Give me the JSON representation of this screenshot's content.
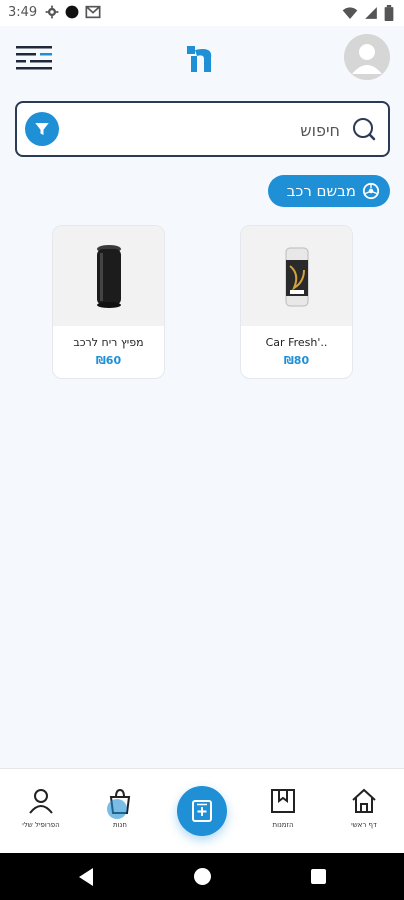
{
  "status_bar": {
    "time": "3:49",
    "icons": [
      "settings-icon",
      "dot-icon",
      "mail-icon",
      "wifi-icon",
      "signal-icon",
      "battery-icon"
    ]
  },
  "header": {
    "menu_icon": "menu-lines-icon",
    "logo": "app-logo",
    "avatar_icon": "user-avatar-icon"
  },
  "search": {
    "placeholder": "חיפוש",
    "value": ""
  },
  "category_chip": {
    "label": "מבשם רכב"
  },
  "products": [
    {
      "name": "Car Fresh'..",
      "price": "₪80"
    },
    {
      "name": "מפיץ ריח לרכב",
      "price": "₪60"
    }
  ],
  "bottom_nav": {
    "items": [
      {
        "label": "דף ראשי",
        "icon": "home-icon"
      },
      {
        "label": "הזמנות",
        "icon": "bookmark-icon"
      },
      {
        "label": "",
        "icon": "add-order-icon"
      },
      {
        "label": "חנות",
        "icon": "bag-icon"
      },
      {
        "label": "הפרופיל שלי",
        "icon": "profile-icon"
      }
    ]
  },
  "colors": {
    "primary": "#1f8fd6",
    "background": "#f5f8fc",
    "border_dark": "#2b3a55"
  }
}
